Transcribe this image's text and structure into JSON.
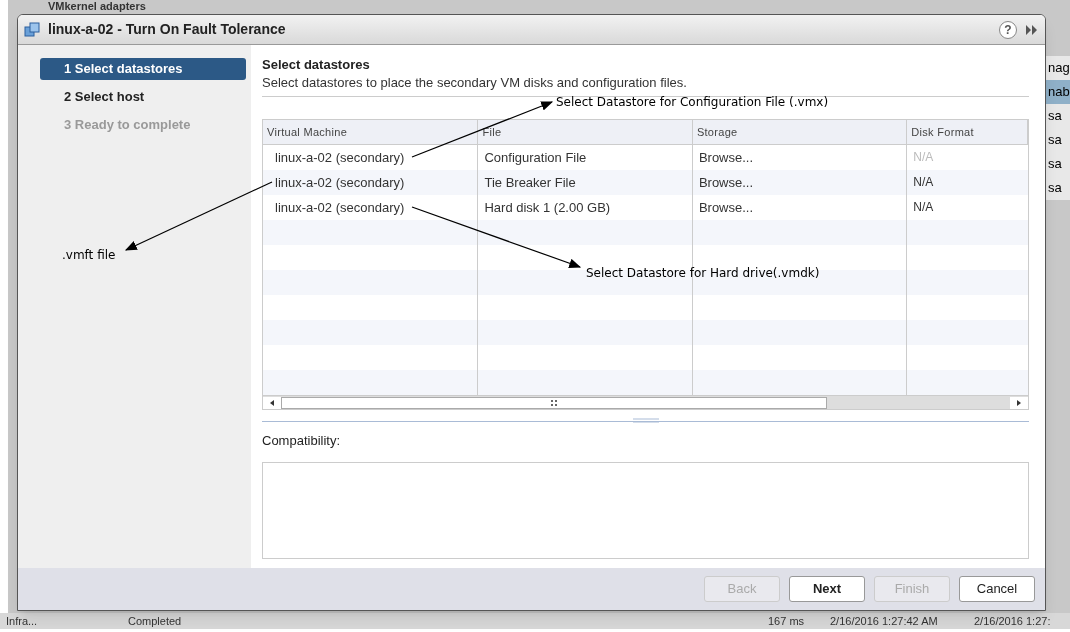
{
  "background": {
    "header": "VMkernel adapters",
    "side_cells": [
      "nag",
      "nab",
      "sa",
      "sa",
      "sa",
      "sa"
    ],
    "status_cells": [
      "Infra...",
      "Completed",
      "167 ms",
      "2/16/2016 1:27:42 AM",
      "2/16/2016 1:27:"
    ]
  },
  "window": {
    "title": "linux-a-02 - Turn On Fault Tolerance",
    "help": "?"
  },
  "steps": [
    {
      "label": "1 Select datastores",
      "selected": true,
      "disabled": false
    },
    {
      "label": "2 Select host",
      "selected": false,
      "disabled": false
    },
    {
      "label": "3 Ready to complete",
      "selected": false,
      "disabled": true
    }
  ],
  "page": {
    "title": "Select datastores",
    "subtitle": "Select datastores to place the secondary VM disks and configuration files."
  },
  "table": {
    "columns": [
      "Virtual Machine",
      "File",
      "Storage",
      "Disk Format"
    ],
    "rows": [
      {
        "vm": "linux-a-02 (secondary)",
        "file": "Configuration File",
        "storage": "Browse...",
        "format": "N/A",
        "format_disabled": true
      },
      {
        "vm": "linux-a-02 (secondary)",
        "file": "Tie Breaker File",
        "storage": "Browse...",
        "format": "N/A",
        "format_disabled": false
      },
      {
        "vm": "linux-a-02 (secondary)",
        "file": "Hard disk 1 (2.00 GB)",
        "storage": "Browse...",
        "format": "N/A",
        "format_disabled": false
      }
    ]
  },
  "compatibility": {
    "label": "Compatibility:"
  },
  "buttons": [
    {
      "label": "Back",
      "disabled": true,
      "default": false
    },
    {
      "label": "Next",
      "disabled": false,
      "default": true
    },
    {
      "label": "Finish",
      "disabled": true,
      "default": false
    },
    {
      "label": "Cancel",
      "disabled": false,
      "default": false
    }
  ],
  "annotations": [
    {
      "text": "Select Datastore for Configuration File (.vmx)"
    },
    {
      "text": ".vmft file"
    },
    {
      "text": "Select Datastore for Hard drive(.vmdk)"
    }
  ]
}
